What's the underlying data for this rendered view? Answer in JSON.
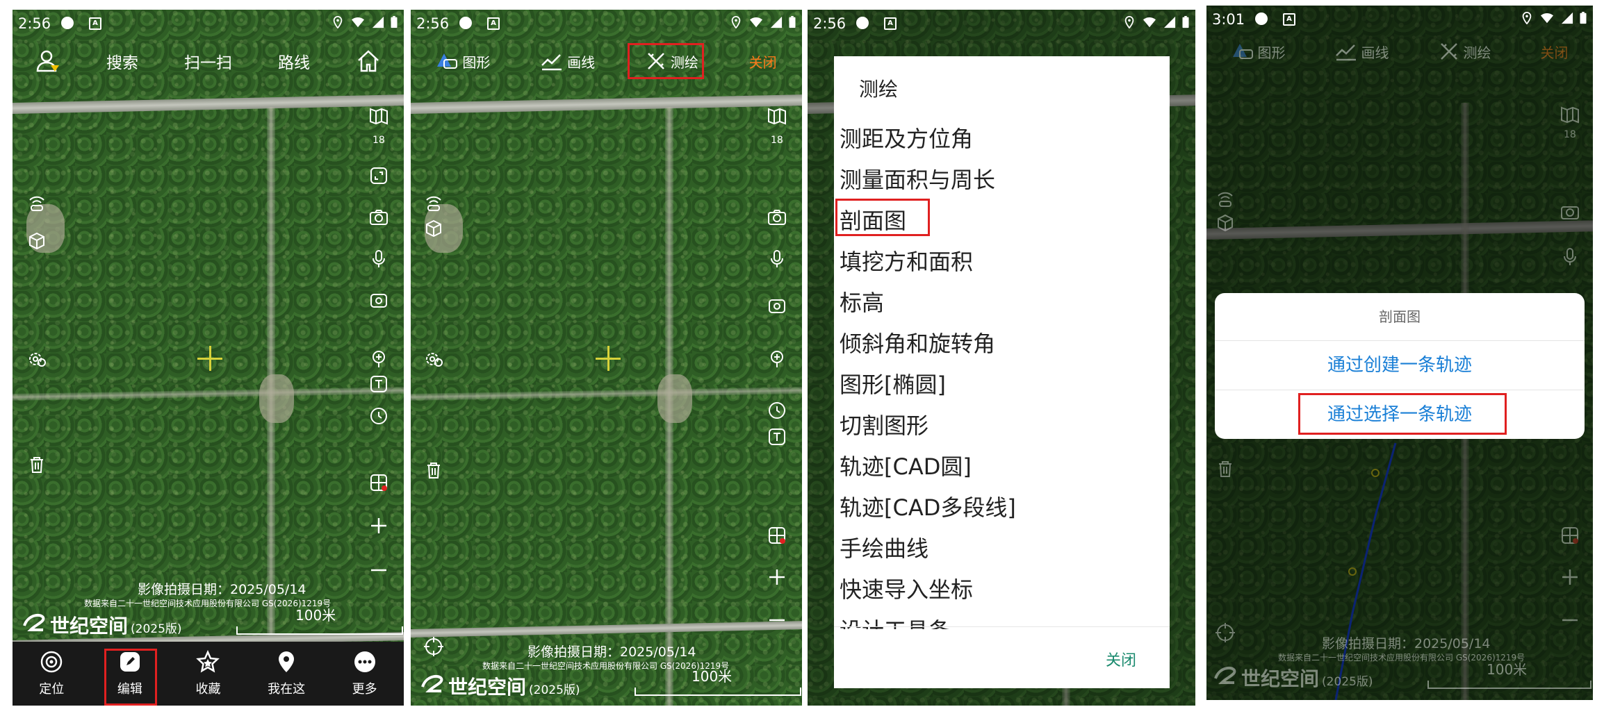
{
  "colors": {
    "accent_orange": "#ff7a1a",
    "highlight_red": "#e02020",
    "link_blue": "#1a7fd6",
    "close_green": "#1a8a6e"
  },
  "screen1": {
    "status_time": "2:56",
    "topbar": {
      "search": "搜索",
      "scan": "扫一扫",
      "route": "路线"
    },
    "zoom_level": "18",
    "capture_date": "影像拍摄日期：2025/05/14",
    "data_source": "数据来自二十一世纪空间技术应用股份有限公司 GS(2026)1219号",
    "logo": "世纪空间",
    "logo_version": "(2025版)",
    "scale": "100米",
    "nav": [
      {
        "label": "定位",
        "icon": "target-icon"
      },
      {
        "label": "编辑",
        "icon": "edit-icon"
      },
      {
        "label": "收藏",
        "icon": "star-icon"
      },
      {
        "label": "我在这",
        "icon": "pin-icon"
      },
      {
        "label": "更多",
        "icon": "more-icon"
      }
    ]
  },
  "screen2": {
    "status_time": "2:56",
    "topbar": {
      "shape": "图形",
      "draw_line": "画线",
      "survey": "测绘",
      "close": "关闭"
    },
    "zoom_level": "18",
    "capture_date": "影像拍摄日期：2025/05/14",
    "data_source": "数据来自二十一世纪空间技术应用股份有限公司 GS(2026)1219号",
    "logo": "世纪空间",
    "logo_version": "(2025版)",
    "scale": "100米"
  },
  "screen3": {
    "status_time": "2:56",
    "dialog_title": "测绘",
    "items": [
      "测距及方位角",
      "测量面积与周长",
      "剖面图",
      "填挖方和面积",
      "标高",
      "倾斜角和旋转角",
      "图形[椭圆]",
      "切割图形",
      "轨迹[CAD圆]",
      "轨迹[CAD多段线]",
      "手绘曲线",
      "快速导入坐标",
      "设计工具条"
    ],
    "close": "关闭"
  },
  "screen4": {
    "status_time": "3:01",
    "topbar": {
      "shape": "图形",
      "draw_line": "画线",
      "survey": "测绘",
      "close": "关闭"
    },
    "zoom_level": "18",
    "sheet_title": "剖面图",
    "option_create": "通过创建一条轨迹",
    "option_select": "通过选择一条轨迹",
    "capture_date": "影像拍摄日期：2025/05/14",
    "data_source": "数据来自二十一世纪空间技术应用股份有限公司 GS(2026)1219号",
    "logo": "世纪空间",
    "logo_version": "(2025版)",
    "scale": "100米"
  }
}
